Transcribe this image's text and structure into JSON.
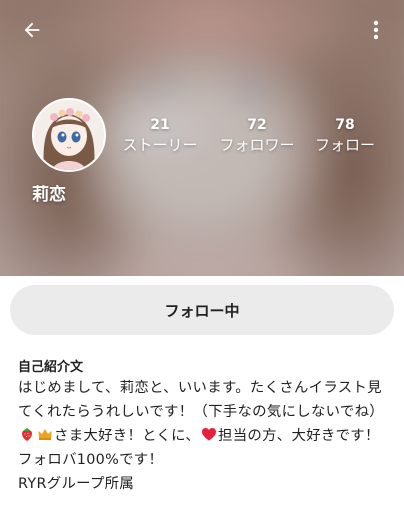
{
  "colors": {
    "header_overlay": "#6d5a5a",
    "text_on_header": "#ffffff",
    "button_bg": "#ebebeb",
    "text_main": "#222222",
    "heart": "#e8213a",
    "strawberry": "#e6293b",
    "crown": "#f2a11a"
  },
  "header": {
    "back_icon": "arrow-left-icon",
    "more_icon": "more-vertical-icon"
  },
  "profile": {
    "name": "莉恋",
    "stats": [
      {
        "value": "21",
        "label": "ストーリー"
      },
      {
        "value": "72",
        "label": "フォロワー"
      },
      {
        "value": "78",
        "label": "フォロー"
      }
    ]
  },
  "follow_button": {
    "label": "フォロー中"
  },
  "bio": {
    "title": "自己紹介文",
    "part1": "はじめまして、莉恋と、いいます。たくさんイラスト見てくれたらうれしいです！（下手なの気にしないでね）",
    "part2": "さま大好き！とくに、",
    "part3": "担当の方、大好きです！フォロバ100%です！",
    "line_last": "RYRグループ所属",
    "emoji": [
      "strawberry-icon",
      "crown-icon",
      "heart-icon"
    ]
  }
}
